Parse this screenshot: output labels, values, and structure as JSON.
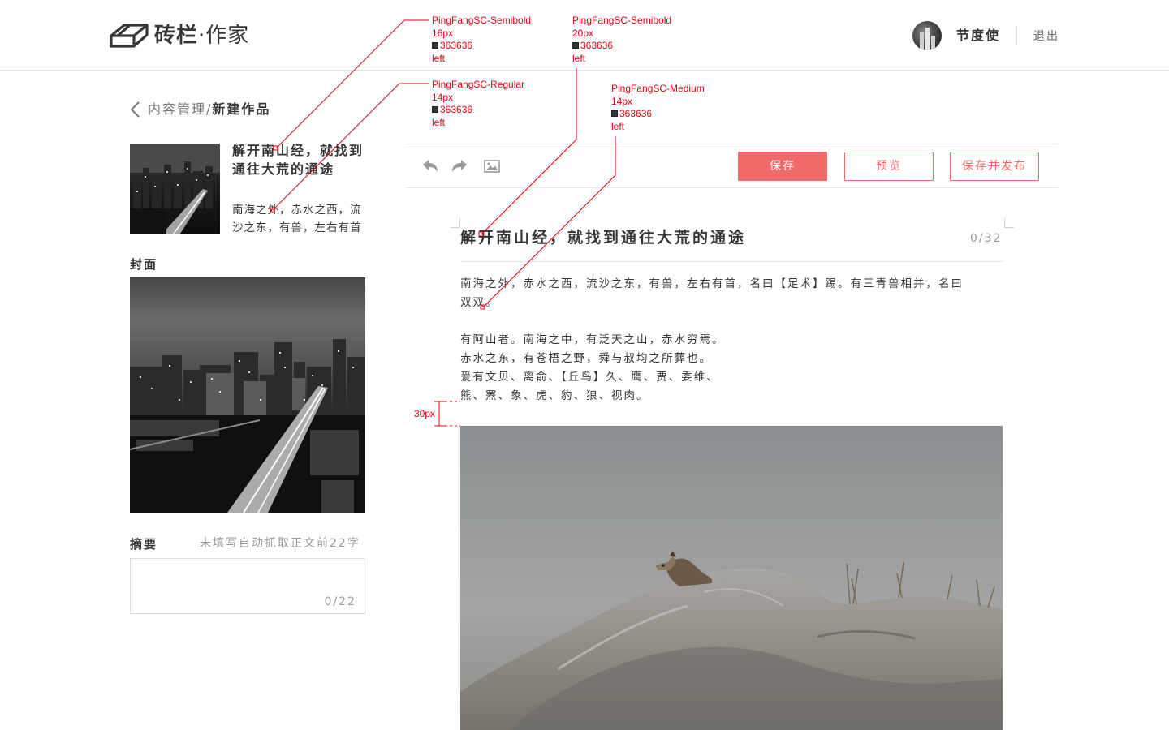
{
  "header": {
    "logo_brand": "砖栏",
    "logo_dot": "·",
    "logo_sub": "作家",
    "username": "节度使",
    "logout_label": "退出"
  },
  "breadcrumb": {
    "parent": "内容管理",
    "separator": "/",
    "current": "新建作品"
  },
  "preview_card": {
    "title": "解开南山经，就找到通往大荒的通途",
    "excerpt": "南海之外，赤水之西，流沙之东，有兽，左右有首"
  },
  "cover": {
    "label": "封面"
  },
  "summary": {
    "label": "摘要",
    "hint": "未填写自动抓取正文前22字",
    "value": "",
    "count": "0/22"
  },
  "toolbar": {
    "undo_icon": "undo-icon",
    "redo_icon": "redo-icon",
    "image_icon": "image-icon",
    "save_label": "保存",
    "preview_label": "预览",
    "publish_label": "保存并发布"
  },
  "editor": {
    "title_value": "解开南山经，就找到通往大荒的通途",
    "title_count": "0/32",
    "paragraphs": [
      [
        "南海之外，赤水之西，流沙之东，有兽，左右有首，名曰【足术】踢。有三青兽相并，名曰",
        "双双。"
      ],
      [
        "有阿山者。南海之中，有泛天之山，赤水穷焉。",
        "赤水之东，有苍梧之野，舜与叔均之所葬也。",
        "爰有文贝、离俞、【丘鸟】久、鹰、贾、委维、",
        "熊、罴、象、虎、豹、狼、视肉。"
      ]
    ]
  },
  "annotations": {
    "a1": {
      "font": "PingFangSC-Semibold",
      "size": "16px",
      "color": "363636",
      "align": "left"
    },
    "a2": {
      "font": "PingFangSC-Semibold",
      "size": "20px",
      "color": "363636",
      "align": "left"
    },
    "a3": {
      "font": "PingFangSC-Regular",
      "size": "14px",
      "color": "363636",
      "align": "left"
    },
    "a4": {
      "font": "PingFangSC-Medium",
      "size": "14px",
      "color": "363636",
      "align": "left"
    },
    "spacing": "30px"
  },
  "colors": {
    "accent": "#f46a6a",
    "text": "#363636",
    "annotation": "#e60012"
  }
}
